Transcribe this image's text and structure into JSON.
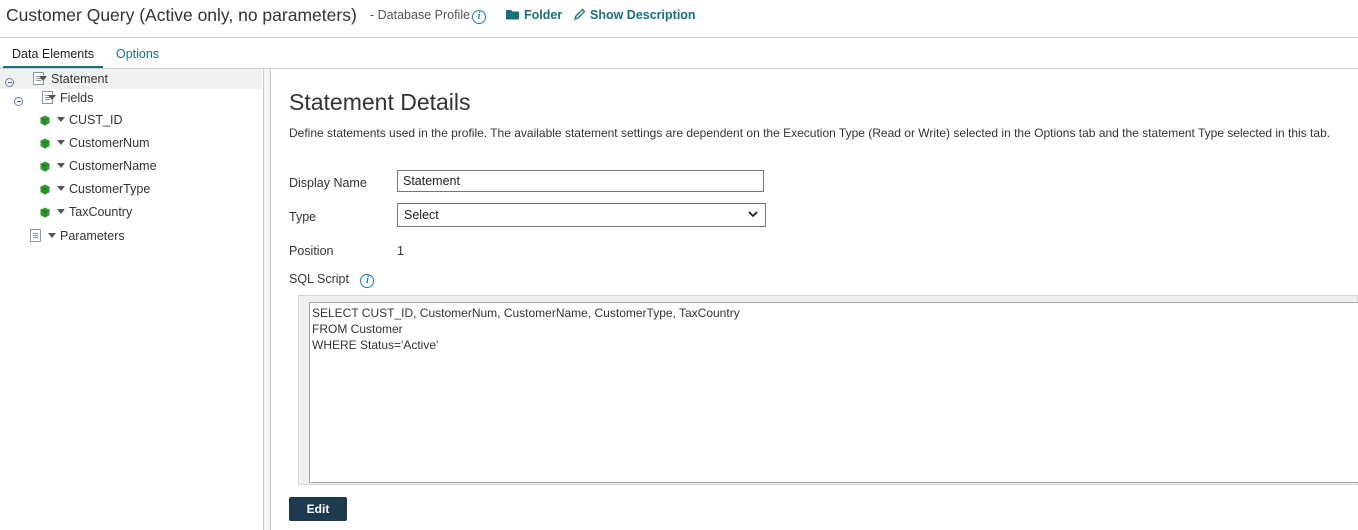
{
  "header": {
    "title": "Customer Query (Active only, no parameters)",
    "subtitle": "- Database Profile",
    "folder_label": "Folder",
    "show_description_label": "Show Description"
  },
  "tabs": [
    {
      "label": "Data Elements",
      "active": true
    },
    {
      "label": "Options",
      "active": false
    }
  ],
  "tree": {
    "statement": "Statement",
    "fields": "Fields",
    "field_items": [
      "CUST_ID",
      "CustomerNum",
      "CustomerName",
      "CustomerType",
      "TaxCountry"
    ],
    "parameters": "Parameters"
  },
  "details": {
    "heading": "Statement Details",
    "description": "Define statements used in the profile. The available statement settings are dependent on the Execution Type (Read or Write) selected in the Options tab and the statement Type selected in this tab.",
    "display_name_label": "Display Name",
    "display_name_value": "Statement",
    "type_label": "Type",
    "type_value": "Select",
    "position_label": "Position",
    "position_value": "1",
    "sql_label": "SQL Script",
    "sql_lines": [
      "SELECT CUST_ID, CustomerNum, CustomerName, CustomerType, TaxCountry",
      "FROM Customer",
      "WHERE Status='Active'"
    ],
    "edit_label": "Edit"
  },
  "colors": {
    "link": "#1a6f7d",
    "button": "#1d3a4f",
    "field_icon": "#2e9a2e",
    "info_icon": "#1b79b5"
  }
}
